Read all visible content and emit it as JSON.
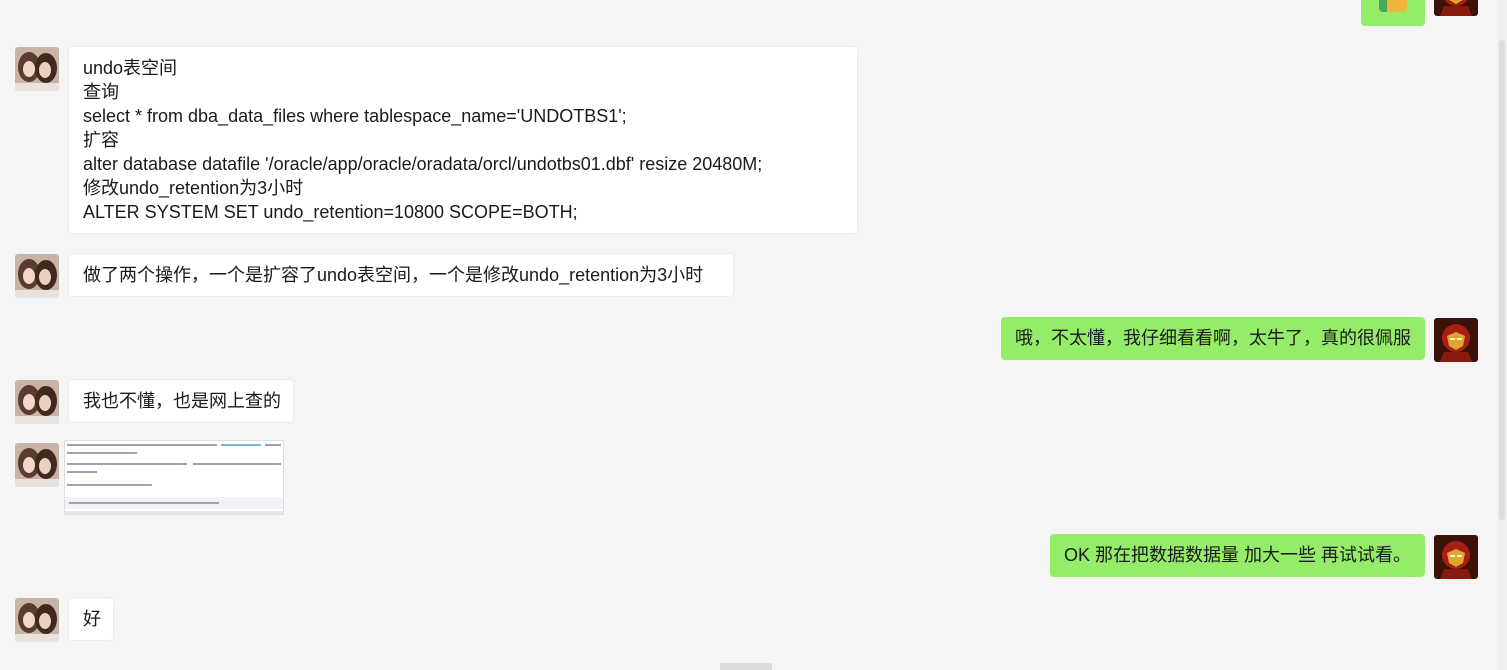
{
  "messages": [
    {
      "side": "left",
      "lines": [
        "undo表空间",
        "查询",
        "select *  from dba_data_files where tablespace_name='UNDOTBS1';",
        "扩容",
        "alter database datafile  '/oracle/app/oracle/oradata/orcl/undotbs01.dbf' resize 20480M;",
        "修改undo_retention为3小时",
        "ALTER SYSTEM SET undo_retention=10800 SCOPE=BOTH;"
      ]
    },
    {
      "side": "left",
      "text": "做了两个操作，一个是扩容了undo表空间，一个是修改undo_retention为3小时"
    },
    {
      "side": "right",
      "text": "哦，不太懂，我仔细看看啊，太牛了，真的很佩服"
    },
    {
      "side": "left",
      "text": "我也不懂，也是网上查的"
    },
    {
      "side": "left",
      "type": "image"
    },
    {
      "side": "right",
      "text": "OK 那在把数据数据量 加大一些 再试试看。"
    },
    {
      "side": "left",
      "text": "好"
    }
  ],
  "colors": {
    "background": "#f5f5f5",
    "left_bubble": "#ffffff",
    "right_bubble": "#95ec69"
  },
  "icons": {
    "left_avatar": "contact-photo-avatar",
    "right_avatar": "ironman-avatar",
    "top_emoji": "thumbs-up-emoji"
  }
}
